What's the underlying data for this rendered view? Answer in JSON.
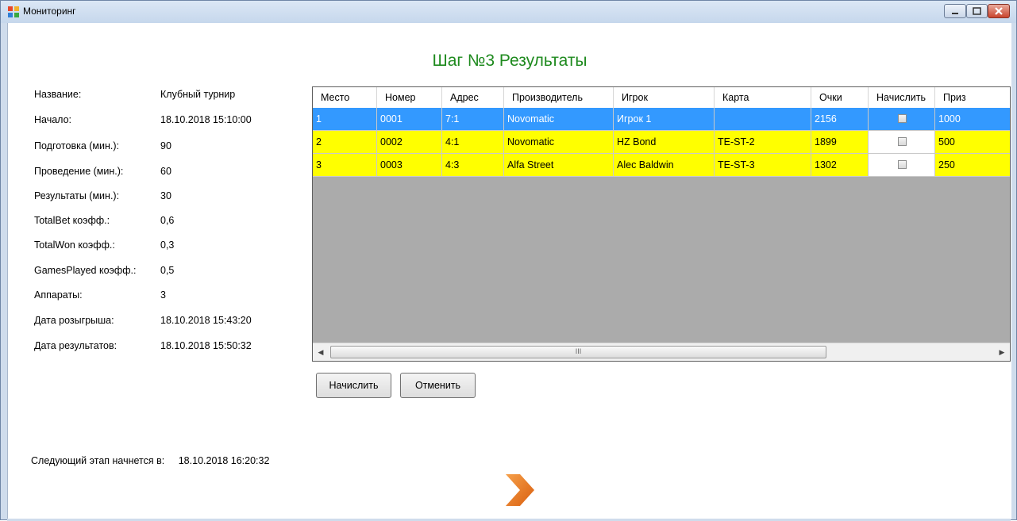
{
  "window": {
    "title": "Мониторинг"
  },
  "heading": "Шаг №3 Результаты",
  "info": [
    {
      "label": "Название:",
      "value": "Клубный турнир"
    },
    {
      "label": "Начало:",
      "value": "18.10.2018 15:10:00"
    },
    {
      "label": "Подготовка (мин.):",
      "value": "90"
    },
    {
      "label": "Проведение (мин.):",
      "value": "60"
    },
    {
      "label": "Результаты (мин.):",
      "value": "30"
    },
    {
      "label": "TotalBet коэфф.:",
      "value": "0,6"
    },
    {
      "label": "TotalWon коэфф.:",
      "value": "0,3"
    },
    {
      "label": "GamesPlayed коэфф.:",
      "value": "0,5"
    },
    {
      "label": "Аппараты:",
      "value": "3"
    },
    {
      "label": "Дата розыгрыша:",
      "value": "18.10.2018 15:43:20"
    },
    {
      "label": "Дата результатов:",
      "value": "18.10.2018 15:50:32"
    }
  ],
  "next_stage": {
    "label": "Следующий этап начнется в:",
    "value": "18.10.2018 16:20:32"
  },
  "table": {
    "columns": [
      "Место",
      "Номер",
      "Адрес",
      "Производитель",
      "Игрок",
      "Карта",
      "Очки",
      "Начислить",
      "Приз"
    ],
    "rows": [
      {
        "place": "1",
        "number": "0001",
        "address": "7:1",
        "manufacturer": "Novomatic",
        "player": "Игрок 1",
        "card": "",
        "points": "2156",
        "accrue": false,
        "prize": "1000",
        "state": "selected"
      },
      {
        "place": "2",
        "number": "0002",
        "address": "4:1",
        "manufacturer": "Novomatic",
        "player": "HZ Bond",
        "card": "TE-ST-2",
        "points": "1899",
        "accrue": false,
        "prize": "500",
        "state": "yellow"
      },
      {
        "place": "3",
        "number": "0003",
        "address": "4:3",
        "manufacturer": "Alfa Street",
        "player": "Alec Baldwin",
        "card": "TE-ST-3",
        "points": "1302",
        "accrue": false,
        "prize": "250",
        "state": "yellow"
      }
    ]
  },
  "buttons": {
    "accrue": "Начислить",
    "cancel": "Отменить"
  },
  "scrollbar": {
    "thumb_grip": "III"
  },
  "colors": {
    "heading": "#1e8a1e",
    "selected_row": "#3399ff",
    "highlight_row": "#ffff00",
    "grid_background": "#ababab",
    "next_arrow": "#e8731c"
  }
}
